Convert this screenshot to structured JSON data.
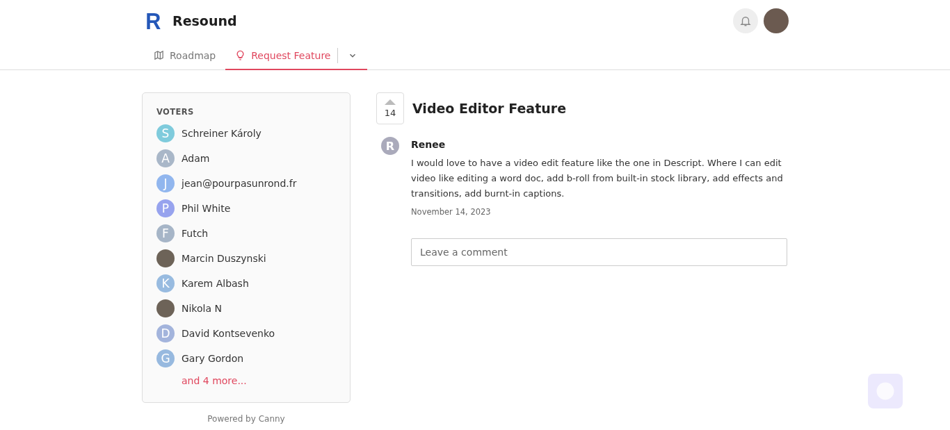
{
  "header": {
    "logo_letter": "R",
    "title": "Resound"
  },
  "tabs": [
    {
      "label": "Roadmap",
      "kind": "map",
      "selected": false
    },
    {
      "label": "Request Feature",
      "kind": "bulb",
      "selected": true
    }
  ],
  "voters": {
    "heading": "VOTERS",
    "more": "and 4 more...",
    "items": [
      {
        "kind": "letter",
        "initial": "S",
        "name": "Schreiner Károly",
        "color": "#7fcbdc"
      },
      {
        "kind": "letter",
        "initial": "A",
        "name": "Adam",
        "color": "#a9b7c8"
      },
      {
        "kind": "letter",
        "initial": "J",
        "name": "jean@pourpasunrond.fr",
        "color": "#91b6ee"
      },
      {
        "kind": "letter",
        "initial": "P",
        "name": "Phil White",
        "color": "#97a3ee"
      },
      {
        "kind": "letter",
        "initial": "F",
        "name": "Futch",
        "color": "#a6b5c7"
      },
      {
        "kind": "photo",
        "name": "Marcin Duszynski"
      },
      {
        "kind": "letter",
        "initial": "K",
        "name": "Karem Albash",
        "color": "#98bbe0"
      },
      {
        "kind": "photo",
        "name": "Nikola N"
      },
      {
        "kind": "letter",
        "initial": "D",
        "name": "David Kontsevenko",
        "color": "#a3b4dc"
      },
      {
        "kind": "letter",
        "initial": "G",
        "name": "Gary Gordon",
        "color": "#97b9df"
      }
    ]
  },
  "powered_by": "Powered by Canny",
  "post": {
    "votes": "14",
    "title": "Video Editor Feature",
    "author_initial": "R",
    "author": "Renee",
    "body": "I would love to have a video edit feature like the one in Descript. Where I can edit video like editing a word doc, add b-roll from built-in stock library, add effects and transitions, add burnt-in captions.",
    "date": "November 14, 2023",
    "comment_placeholder": "Leave a comment"
  }
}
